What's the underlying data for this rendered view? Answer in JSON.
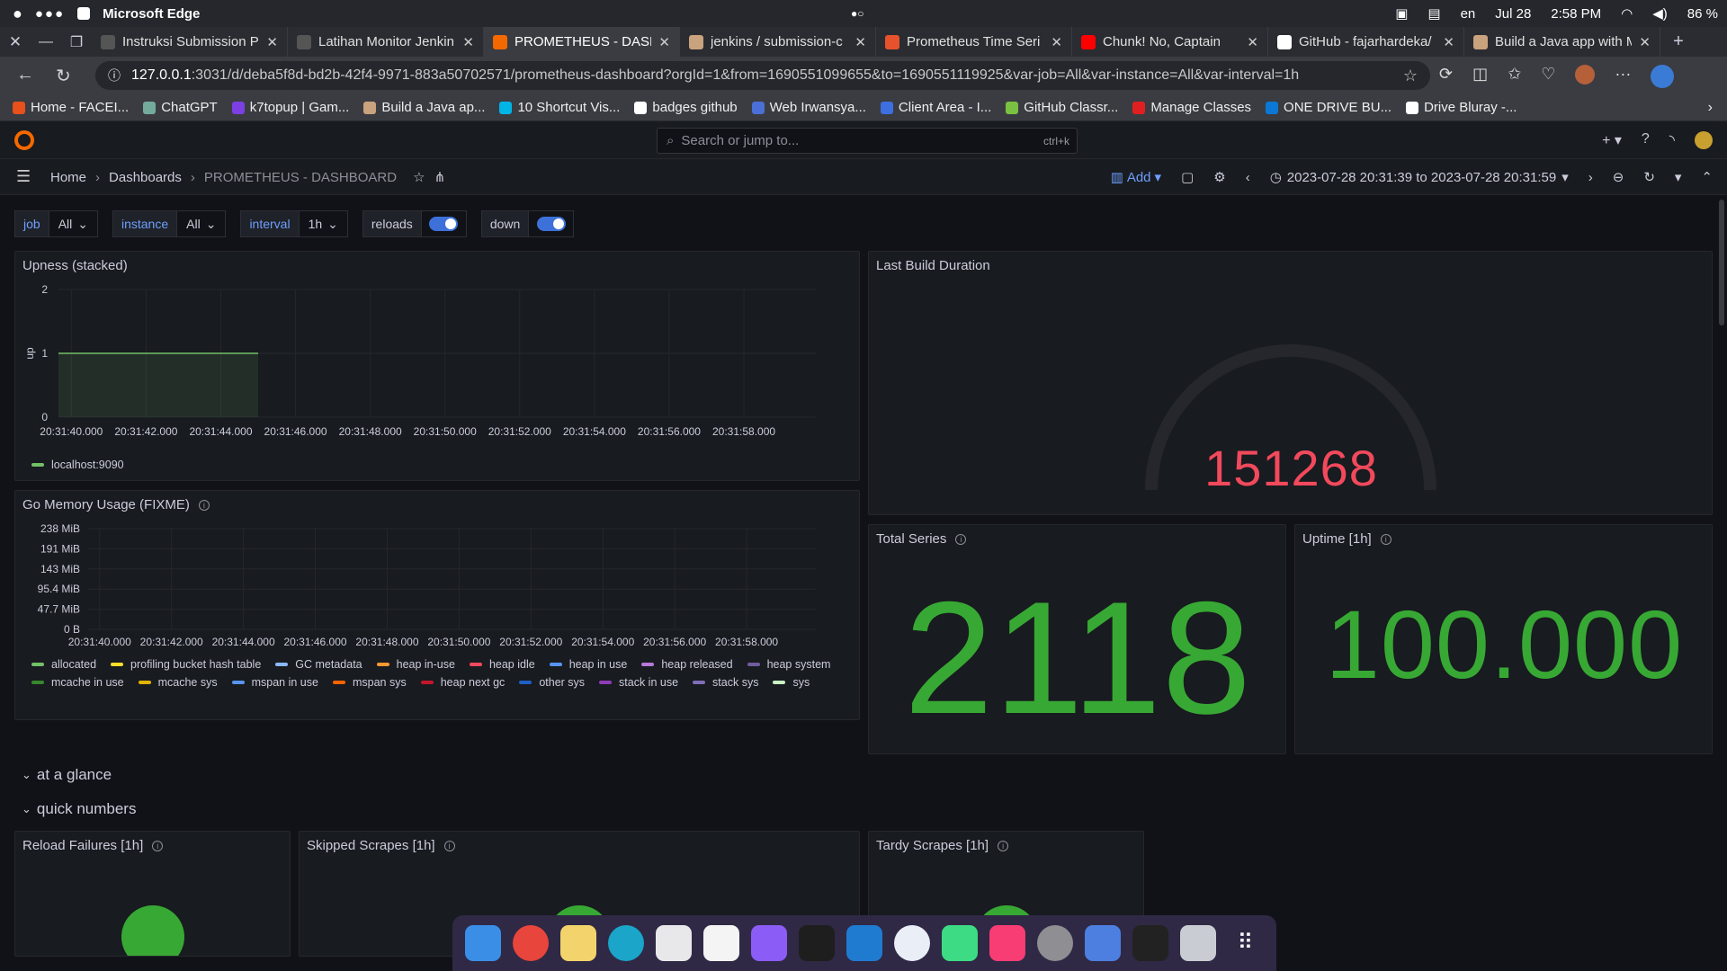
{
  "os": {
    "app_name": "Microsoft Edge",
    "lang": "en",
    "date": "Jul 28",
    "time": "2:58 PM",
    "battery": "86 %"
  },
  "browser": {
    "tabs": [
      {
        "label": "Instruksi Submission P",
        "color": "#555"
      },
      {
        "label": "Latihan Monitor Jenkin",
        "color": "#555"
      },
      {
        "label": "PROMETHEUS - DASH",
        "color": "#f46800",
        "active": true
      },
      {
        "label": "jenkins / submission-c",
        "color": "#c9a27e"
      },
      {
        "label": "Prometheus Time Seri",
        "color": "#e6522c"
      },
      {
        "label": "Chunk! No, Captain",
        "color": "#ff0000"
      },
      {
        "label": "GitHub - fajarhardeka/",
        "color": "#ffffff"
      },
      {
        "label": "Build a Java app with M",
        "color": "#c9a27e"
      }
    ],
    "url_host": "127.0.0.1",
    "url_rest": ":3031/d/deba5f8d-bd2b-42f4-9971-883a50702571/prometheus-dashboard?orgId=1&from=1690551099655&to=1690551119925&var-job=All&var-instance=All&var-interval=1h",
    "bookmarks": [
      {
        "label": "Home - FACEI...",
        "color": "#e8501c"
      },
      {
        "label": "ChatGPT",
        "color": "#74aa9c"
      },
      {
        "label": "k7topup | Gam...",
        "color": "#7b3fe4"
      },
      {
        "label": "Build a Java ap...",
        "color": "#c9a27e"
      },
      {
        "label": "10 Shortcut Vis...",
        "color": "#00b4e6"
      },
      {
        "label": "badges github",
        "color": "#ffffff"
      },
      {
        "label": "Web Irwansya...",
        "color": "#4a6fd6"
      },
      {
        "label": "Client Area - I...",
        "color": "#3d6fe0"
      },
      {
        "label": "GitHub Classr...",
        "color": "#7ac143"
      },
      {
        "label": "Manage Classes",
        "color": "#e02020"
      },
      {
        "label": "ONE DRIVE BU...",
        "color": "#0a78d4"
      },
      {
        "label": "Drive Bluray -...",
        "color": "#ffffff"
      }
    ]
  },
  "grafana": {
    "search_placeholder": "Search or jump to...",
    "search_shortcut": "ctrl+k",
    "breadcrumb": {
      "home": "Home",
      "dashboards": "Dashboards",
      "current": "PROMETHEUS - DASHBOARD"
    },
    "add_label": "Add",
    "time_range": "2023-07-28 20:31:39 to 2023-07-28 20:31:59",
    "variables": {
      "job_label": "job",
      "job_value": "All",
      "instance_label": "instance",
      "instance_value": "All",
      "interval_label": "interval",
      "interval_value": "1h",
      "reloads_label": "reloads",
      "down_label": "down"
    },
    "panels": {
      "upness": {
        "title": "Upness (stacked)",
        "ylabel": "up",
        "legend": "localhost:9090"
      },
      "memory": {
        "title": "Go Memory Usage (FIXME)"
      },
      "build": {
        "title": "Last Build Duration",
        "value": "151268"
      },
      "series": {
        "title": "Total Series",
        "value": "2118"
      },
      "uptime": {
        "title": "Uptime [1h]",
        "value": "100.000"
      },
      "reload_failures": {
        "title": "Reload Failures [1h]"
      },
      "skipped": {
        "title": "Skipped Scrapes [1h]"
      },
      "tardy": {
        "title": "Tardy Scrapes [1h]"
      }
    },
    "rows": {
      "glance": "at a glance",
      "quick": "quick numbers"
    },
    "colors": {
      "green": "#37a834",
      "red": "#f2495c",
      "accent": "#6e9fff"
    }
  },
  "chart_data": [
    {
      "type": "area",
      "title": "Upness (stacked)",
      "ylabel": "up",
      "x": [
        "20:31:40.000",
        "20:31:42.000",
        "20:31:44.000",
        "20:31:46.000",
        "20:31:48.000",
        "20:31:50.000",
        "20:31:52.000",
        "20:31:54.000",
        "20:31:56.000",
        "20:31:58.000"
      ],
      "ylim": [
        0,
        2
      ],
      "yticks": [
        "0",
        "1",
        "2"
      ],
      "series": [
        {
          "name": "localhost:9090",
          "color": "#73bf69",
          "points": [
            [
              "20:31:39.655",
              1
            ],
            [
              "20:31:45.000",
              1
            ]
          ]
        }
      ]
    },
    {
      "type": "line",
      "title": "Go Memory Usage (FIXME)",
      "x": [
        "20:31:40.000",
        "20:31:42.000",
        "20:31:44.000",
        "20:31:46.000",
        "20:31:48.000",
        "20:31:50.000",
        "20:31:52.000",
        "20:31:54.000",
        "20:31:56.000",
        "20:31:58.000"
      ],
      "yticks": [
        "0 B",
        "47.7 MiB",
        "95.4 MiB",
        "143 MiB",
        "191 MiB",
        "238 MiB"
      ],
      "series": [
        {
          "name": "allocated",
          "color": "#73bf69"
        },
        {
          "name": "profiling bucket hash table",
          "color": "#fade2a"
        },
        {
          "name": "GC metadata",
          "color": "#8ab8ff"
        },
        {
          "name": "heap in-use",
          "color": "#ff9830"
        },
        {
          "name": "heap idle",
          "color": "#f2495c"
        },
        {
          "name": "heap in use",
          "color": "#5794f2"
        },
        {
          "name": "heap released",
          "color": "#b877d9"
        },
        {
          "name": "heap system",
          "color": "#705da0"
        },
        {
          "name": "mcache in use",
          "color": "#37872d"
        },
        {
          "name": "mcache sys",
          "color": "#e0b400"
        },
        {
          "name": "mspan in use",
          "color": "#5794f2"
        },
        {
          "name": "mspan sys",
          "color": "#fa6400"
        },
        {
          "name": "heap next gc",
          "color": "#c4162a"
        },
        {
          "name": "other sys",
          "color": "#1f60c4"
        },
        {
          "name": "stack in use",
          "color": "#8f3bb8"
        },
        {
          "name": "stack sys",
          "color": "#806eb7"
        },
        {
          "name": "sys",
          "color": "#c8f2c2"
        }
      ]
    }
  ]
}
